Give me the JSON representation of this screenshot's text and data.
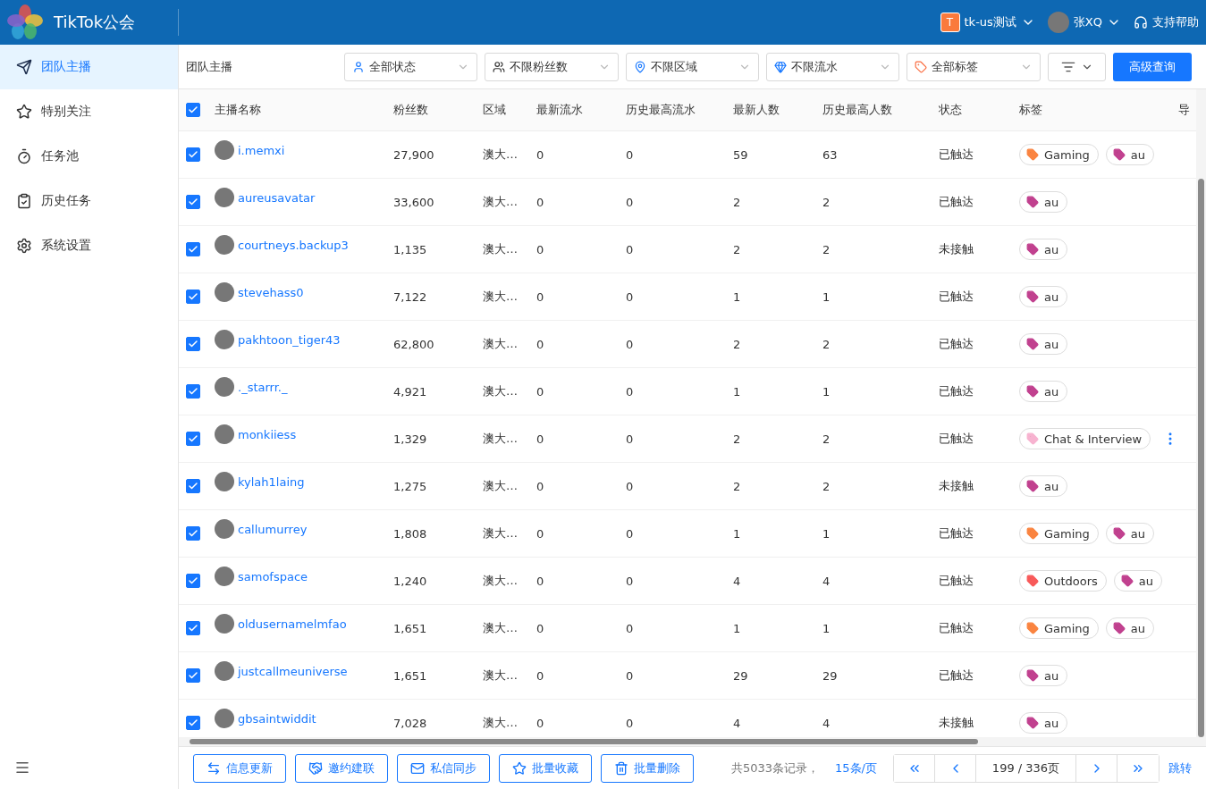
{
  "app": {
    "title": "TikTok公会",
    "account": {
      "badge": "T",
      "name": "tk-us测试"
    },
    "user": {
      "name": "张XQ"
    },
    "help": "支持帮助"
  },
  "sidebar": {
    "items": [
      {
        "label": "团队主播",
        "selected": true
      },
      {
        "label": "特别关注",
        "selected": false
      },
      {
        "label": "任务池",
        "selected": false
      },
      {
        "label": "历史任务",
        "selected": false
      },
      {
        "label": "系统设置",
        "selected": false
      }
    ]
  },
  "toolbar": {
    "title": "团队主播",
    "filters": [
      {
        "label": "全部状态"
      },
      {
        "label": "不限粉丝数"
      },
      {
        "label": "不限区域"
      },
      {
        "label": "不限流水"
      },
      {
        "label": "全部标签"
      }
    ],
    "query_button": "高级查询"
  },
  "table": {
    "select_all": true,
    "columns": [
      "主播名称",
      "粉丝数",
      "区域",
      "最新流水",
      "历史最高流水",
      "最新人数",
      "历史最高人数",
      "状态",
      "标签",
      "导"
    ],
    "rows": [
      {
        "checked": true,
        "name": "i.memxi",
        "fans": "27,900",
        "region": "澳大…",
        "latest_flow": "0",
        "max_flow": "0",
        "latest_viewers": "59",
        "max_viewers": "63",
        "status": "已触达",
        "tags": [
          {
            "label": "Gaming",
            "color": "#fa8440"
          },
          {
            "label": "au",
            "color": "#c1418f"
          }
        ],
        "more": false
      },
      {
        "checked": true,
        "name": "aureusavatar",
        "fans": "33,600",
        "region": "澳大…",
        "latest_flow": "0",
        "max_flow": "0",
        "latest_viewers": "2",
        "max_viewers": "2",
        "status": "已触达",
        "tags": [
          {
            "label": "au",
            "color": "#c1418f"
          }
        ],
        "more": false
      },
      {
        "checked": true,
        "name": "courtneys.backup3",
        "fans": "1,135",
        "region": "澳大…",
        "latest_flow": "0",
        "max_flow": "0",
        "latest_viewers": "2",
        "max_viewers": "2",
        "status": "未接触",
        "tags": [
          {
            "label": "au",
            "color": "#c1418f"
          }
        ],
        "more": false
      },
      {
        "checked": true,
        "name": "stevehass0",
        "fans": "7,122",
        "region": "澳大…",
        "latest_flow": "0",
        "max_flow": "0",
        "latest_viewers": "1",
        "max_viewers": "1",
        "status": "已触达",
        "tags": [
          {
            "label": "au",
            "color": "#c1418f"
          }
        ],
        "more": false
      },
      {
        "checked": true,
        "name": "pakhtoon_tiger43",
        "fans": "62,800",
        "region": "澳大…",
        "latest_flow": "0",
        "max_flow": "0",
        "latest_viewers": "2",
        "max_viewers": "2",
        "status": "已触达",
        "tags": [
          {
            "label": "au",
            "color": "#c1418f"
          }
        ],
        "more": false
      },
      {
        "checked": true,
        "name": "._starrr._",
        "fans": "4,921",
        "region": "澳大…",
        "latest_flow": "0",
        "max_flow": "0",
        "latest_viewers": "1",
        "max_viewers": "1",
        "status": "已触达",
        "tags": [
          {
            "label": "au",
            "color": "#c1418f"
          }
        ],
        "more": false
      },
      {
        "checked": true,
        "name": "monkiiess",
        "fans": "1,329",
        "region": "澳大…",
        "latest_flow": "0",
        "max_flow": "0",
        "latest_viewers": "2",
        "max_viewers": "2",
        "status": "已触达",
        "tags": [
          {
            "label": "Chat & Interview",
            "color": "#f7b3d0"
          }
        ],
        "more": true
      },
      {
        "checked": true,
        "name": "kylah1laing",
        "fans": "1,275",
        "region": "澳大…",
        "latest_flow": "0",
        "max_flow": "0",
        "latest_viewers": "2",
        "max_viewers": "2",
        "status": "未接触",
        "tags": [
          {
            "label": "au",
            "color": "#c1418f"
          }
        ],
        "more": false
      },
      {
        "checked": true,
        "name": "callumurrey",
        "fans": "1,808",
        "region": "澳大…",
        "latest_flow": "0",
        "max_flow": "0",
        "latest_viewers": "1",
        "max_viewers": "1",
        "status": "已触达",
        "tags": [
          {
            "label": "Gaming",
            "color": "#fa8440"
          },
          {
            "label": "au",
            "color": "#c1418f"
          }
        ],
        "more": false
      },
      {
        "checked": true,
        "name": "samofspace",
        "fans": "1,240",
        "region": "澳大…",
        "latest_flow": "0",
        "max_flow": "0",
        "latest_viewers": "4",
        "max_viewers": "4",
        "status": "已触达",
        "tags": [
          {
            "label": "Outdoors",
            "color": "#f85a5a"
          },
          {
            "label": "au",
            "color": "#c1418f"
          }
        ],
        "more": false
      },
      {
        "checked": true,
        "name": "oldusernamelmfao",
        "fans": "1,651",
        "region": "澳大…",
        "latest_flow": "0",
        "max_flow": "0",
        "latest_viewers": "1",
        "max_viewers": "1",
        "status": "已触达",
        "tags": [
          {
            "label": "Gaming",
            "color": "#fa8440"
          },
          {
            "label": "au",
            "color": "#c1418f"
          }
        ],
        "more": false
      },
      {
        "checked": true,
        "name": "justcallmeuniverse",
        "fans": "1,651",
        "region": "澳大…",
        "latest_flow": "0",
        "max_flow": "0",
        "latest_viewers": "29",
        "max_viewers": "29",
        "status": "已触达",
        "tags": [
          {
            "label": "au",
            "color": "#c1418f"
          }
        ],
        "more": false
      },
      {
        "checked": true,
        "name": "gbsaintwiddit",
        "fans": "7,028",
        "region": "澳大…",
        "latest_flow": "0",
        "max_flow": "0",
        "latest_viewers": "4",
        "max_viewers": "4",
        "status": "未接触",
        "tags": [
          {
            "label": "au",
            "color": "#c1418f"
          }
        ],
        "more": false
      }
    ]
  },
  "actions": [
    {
      "label": "信息更新"
    },
    {
      "label": "邀约建联"
    },
    {
      "label": "私信同步"
    },
    {
      "label": "批量收藏"
    },
    {
      "label": "批量删除"
    }
  ],
  "pagination": {
    "total": "共5033条记录，",
    "page_size": "15条/页",
    "page": "199 / 336页",
    "jump": "跳转"
  }
}
